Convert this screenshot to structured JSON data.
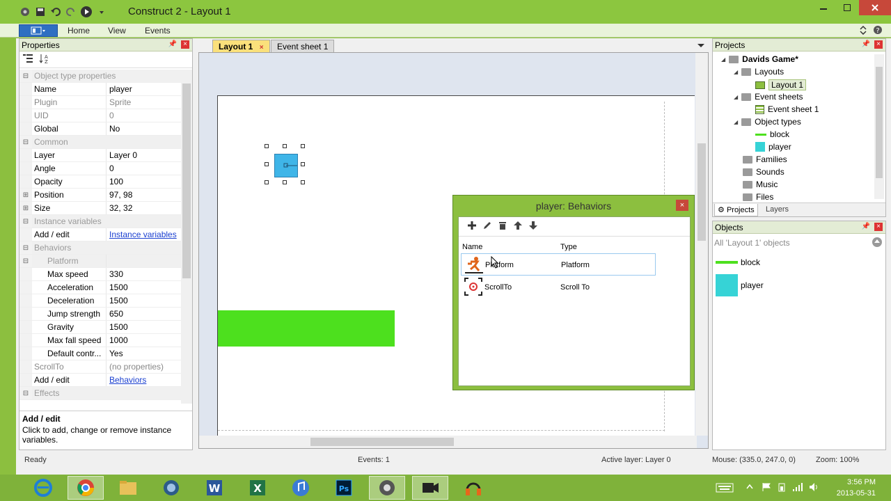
{
  "window": {
    "title": "Construct 2 - Layout 1"
  },
  "ribbon": {
    "tabs": [
      "Home",
      "View",
      "Events"
    ]
  },
  "properties": {
    "title": "Properties",
    "rows": [
      {
        "type": "cat",
        "label": "Object type properties"
      },
      {
        "type": "prop",
        "key": "Name",
        "value": "player"
      },
      {
        "type": "prop",
        "key": "Plugin",
        "value": "Sprite",
        "gray": true
      },
      {
        "type": "prop",
        "key": "UID",
        "value": "0",
        "gray": true
      },
      {
        "type": "prop",
        "key": "Global",
        "value": "No"
      },
      {
        "type": "cat",
        "label": "Common"
      },
      {
        "type": "prop",
        "key": "Layer",
        "value": "Layer 0"
      },
      {
        "type": "prop",
        "key": "Angle",
        "value": "0"
      },
      {
        "type": "prop",
        "key": "Opacity",
        "value": "100"
      },
      {
        "type": "prop",
        "key": "Position",
        "value": "97, 98",
        "exp": "+"
      },
      {
        "type": "prop",
        "key": "Size",
        "value": "32, 32",
        "exp": "+"
      },
      {
        "type": "cat",
        "label": "Instance variables"
      },
      {
        "type": "prop",
        "key": "Add / edit",
        "value": "Instance variables",
        "link": true
      },
      {
        "type": "cat",
        "label": "Behaviors"
      },
      {
        "type": "sub",
        "label": "Platform"
      },
      {
        "type": "prop2",
        "key": "Max speed",
        "value": "330"
      },
      {
        "type": "prop2",
        "key": "Acceleration",
        "value": "1500"
      },
      {
        "type": "prop2",
        "key": "Deceleration",
        "value": "1500"
      },
      {
        "type": "prop2",
        "key": "Jump strength",
        "value": "650"
      },
      {
        "type": "prop2",
        "key": "Gravity",
        "value": "1500"
      },
      {
        "type": "prop2",
        "key": "Max fall speed",
        "value": "1000"
      },
      {
        "type": "prop2",
        "key": "Default contr...",
        "value": "Yes"
      },
      {
        "type": "prop",
        "key": "ScrollTo",
        "value": "(no properties)",
        "gray": true
      },
      {
        "type": "prop",
        "key": "Add / edit",
        "value": "Behaviors",
        "link": true
      },
      {
        "type": "cat",
        "label": "Effects"
      }
    ],
    "help_title": "Add / edit",
    "help_text": "Click to add, change or remove instance variables."
  },
  "doc_tabs": [
    {
      "label": "Layout 1",
      "active": true
    },
    {
      "label": "Event sheet 1",
      "active": false
    }
  ],
  "behaviors_dialog": {
    "title": "player: Behaviors",
    "col_name": "Name",
    "col_type": "Type",
    "rows": [
      {
        "name": "Platform",
        "type": "Platform"
      },
      {
        "name": "ScrollTo",
        "type": "Scroll To"
      }
    ]
  },
  "projects": {
    "title": "Projects",
    "tree": [
      {
        "label": "Davids Game*",
        "level": 0,
        "bold": true,
        "arrow": true,
        "icon": "folder-icon"
      },
      {
        "label": "Layouts",
        "level": 1,
        "arrow": true,
        "icon": "folder-icon"
      },
      {
        "label": "Layout 1",
        "level": 2,
        "icon": "layout-icon",
        "selected": true
      },
      {
        "label": "Event sheets",
        "level": 1,
        "arrow": true,
        "icon": "folder-icon"
      },
      {
        "label": "Event sheet 1",
        "level": 2,
        "icon": "event-sheet-icon"
      },
      {
        "label": "Object types",
        "level": 1,
        "arrow": true,
        "icon": "folder-icon"
      },
      {
        "label": "block",
        "level": 2,
        "icon": "block-swatch-icon"
      },
      {
        "label": "player",
        "level": 2,
        "icon": "player-swatch-icon"
      },
      {
        "label": "Families",
        "level": 1,
        "icon": "folder-icon"
      },
      {
        "label": "Sounds",
        "level": 1,
        "icon": "folder-icon"
      },
      {
        "label": "Music",
        "level": 1,
        "icon": "folder-icon"
      },
      {
        "label": "Files",
        "level": 1,
        "icon": "folder-icon"
      }
    ],
    "tab_projects": "Projects",
    "tab_layers": "Layers"
  },
  "objects": {
    "title": "Objects",
    "filter": "All 'Layout 1' objects",
    "items": [
      {
        "label": "block"
      },
      {
        "label": "player"
      }
    ]
  },
  "status": {
    "ready": "Ready",
    "events": "Events: 1",
    "active_layer": "Active layer: Layer 0",
    "mouse": "Mouse: (335.0, 247.0, 0)",
    "zoom": "Zoom: 100%"
  },
  "taskbar": {
    "time": "3:56 PM",
    "date": "2013-05-31"
  },
  "colors": {
    "accent_green": "#8cc63f",
    "block": "#4de01e",
    "player": "#3fb5e8",
    "active_tab": "#fae07b"
  }
}
